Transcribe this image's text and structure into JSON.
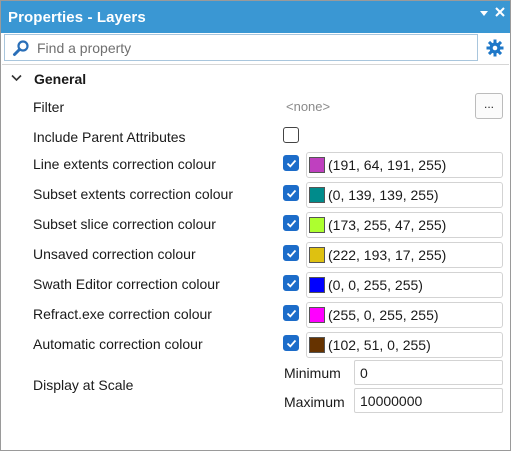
{
  "window": {
    "title": "Properties - Layers"
  },
  "search": {
    "placeholder": "Find a property"
  },
  "group": {
    "title": "General"
  },
  "filter": {
    "label": "Filter",
    "value": "<none>",
    "button": "..."
  },
  "include_parent": {
    "label": "Include Parent Attributes",
    "checked": false
  },
  "colour_rows": [
    {
      "label": "Line extents correction colour",
      "checked": true,
      "value": "(191, 64, 191, 255)",
      "color": "#bf40bf"
    },
    {
      "label": "Subset extents correction colour",
      "checked": true,
      "value": "(0, 139, 139, 255)",
      "color": "#008b8b"
    },
    {
      "label": "Subset slice correction colour",
      "checked": true,
      "value": "(173, 255, 47, 255)",
      "color": "#adff2f"
    },
    {
      "label": "Unsaved correction colour",
      "checked": true,
      "value": "(222, 193, 17, 255)",
      "color": "#dec111"
    },
    {
      "label": "Swath Editor correction colour",
      "checked": true,
      "value": "(0, 0, 255, 255)",
      "color": "#0000ff"
    },
    {
      "label": "Refract.exe correction colour",
      "checked": true,
      "value": "(255, 0, 255, 255)",
      "color": "#ff00ff"
    },
    {
      "label": "Automatic correction colour",
      "checked": true,
      "value": "(102, 51, 0, 255)",
      "color": "#663300"
    }
  ],
  "display_scale": {
    "label": "Display at Scale",
    "minimum_label": "Minimum",
    "minimum_value": "0",
    "maximum_label": "Maximum",
    "maximum_value": "10000000"
  },
  "colors": {
    "titlebar": "#3a97d3",
    "checkbox": "#1c6cc9"
  }
}
